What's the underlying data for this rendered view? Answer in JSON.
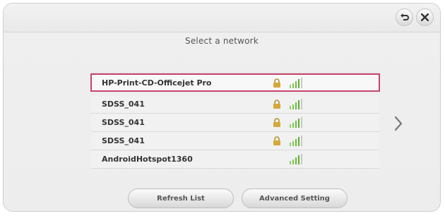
{
  "dialog": {
    "title": "Select a network",
    "networks": [
      {
        "ssid": "HP-Print-CD-Officejet Pro",
        "secured": true,
        "selected": true
      },
      {
        "ssid": "SDSS_041",
        "secured": true,
        "selected": false
      },
      {
        "ssid": "SDSS_041",
        "secured": true,
        "selected": false
      },
      {
        "ssid": "SDSS_041",
        "secured": true,
        "selected": false
      },
      {
        "ssid": "AndroidHotspot1360",
        "secured": false,
        "selected": false
      }
    ],
    "buttons": {
      "refresh": "Refresh List",
      "advanced": "Advanced Setting"
    },
    "icons": {
      "back": "back-icon",
      "close": "close-icon",
      "lock": "lock-icon",
      "signal": "wifi-signal-icon",
      "next": "chevron-right-icon"
    },
    "colors": {
      "selection_border": "#c9436e",
      "signal_green": "#6bbd3a",
      "lock_gold": "#d4a93a"
    }
  }
}
